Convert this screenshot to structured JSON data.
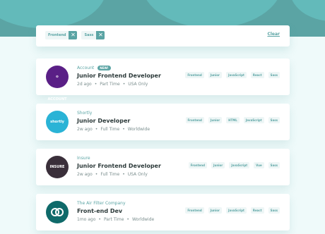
{
  "filters": {
    "active": [
      "Frontend",
      "Sass"
    ],
    "remove_symbol": "✕",
    "clear_label": "Clear"
  },
  "jobs": [
    {
      "company": "Account",
      "badge": "NEW!",
      "logo_text": "⊙ ACCOUNT",
      "position": "Junior Frontend Developer",
      "posted": "2d ago",
      "contract": "Part Time",
      "location": "USA Only",
      "tags": [
        "Frontend",
        "Junior",
        "JavaScript",
        "React",
        "Sass"
      ],
      "logo_color": "#5a1f86"
    },
    {
      "company": "Shortly",
      "badge": "",
      "logo_text": "shortly",
      "position": "Junior Developer",
      "posted": "2w ago",
      "contract": "Full Time",
      "location": "Worldwide",
      "tags": [
        "Frontend",
        "Junior",
        "HTML",
        "JavaScript",
        "Sass"
      ],
      "logo_color": "#2ab3d6"
    },
    {
      "company": "Insure",
      "badge": "",
      "logo_text": "INSURE",
      "position": "Junior Frontend Developer",
      "posted": "2w ago",
      "contract": "Full Time",
      "location": "USA Only",
      "tags": [
        "Frontend",
        "Junior",
        "JavaScript",
        "Vue",
        "Sass"
      ],
      "logo_color": "#3a2f3a"
    },
    {
      "company": "The Air Filter Company",
      "badge": "",
      "logo_text": "",
      "position": "Front-end Dev",
      "posted": "1mo ago",
      "contract": "Part Time",
      "location": "Worldwide",
      "tags": [
        "Frontend",
        "Junior",
        "JavaScript",
        "React",
        "Sass"
      ],
      "logo_color": "#0f6a6a"
    }
  ],
  "colors": {
    "accent": "#5ba4a4",
    "background": "#effafa",
    "tag_bg": "#eef6f6",
    "text_dark": "#2c3a3a",
    "text_muted": "#7b8e8e"
  }
}
